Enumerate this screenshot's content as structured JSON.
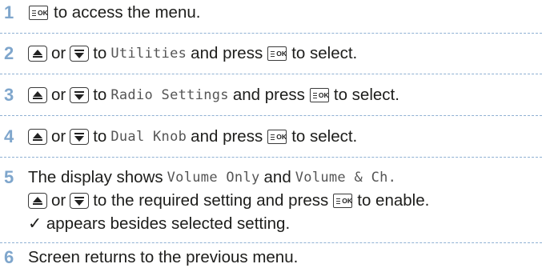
{
  "icons": {
    "ok_key": "menu-ok-key-icon",
    "up_key": "arrow-up-key-icon",
    "down_key": "arrow-down-key-icon",
    "ok_key_label": "OK"
  },
  "colors": {
    "step_number": "#7fa6cc",
    "separator": "#8fb0d3",
    "text": "#1d1d1b",
    "display_text": "#555555"
  },
  "steps": [
    {
      "number": "1",
      "text_after_key": "to access the menu."
    },
    {
      "number": "2",
      "or": "or",
      "to": "to",
      "display_item": "Utilities",
      "and_press": "and press",
      "tail": "to select."
    },
    {
      "number": "3",
      "or": "or",
      "to": "to",
      "display_item": "Radio Settings",
      "and_press": "and press",
      "tail": "to select."
    },
    {
      "number": "4",
      "or": "or",
      "to": "to",
      "display_item": "Dual Knob",
      "and_press": "and press",
      "tail": "to select."
    },
    {
      "number": "5",
      "line1_prefix": "The display shows",
      "option_a": "Volume Only",
      "and": "and",
      "option_b": "Volume & Ch.",
      "or": "or",
      "line2_mid": "to the required setting and press",
      "line2_tail": "to enable.",
      "line3": "✓ appears besides selected setting."
    },
    {
      "number": "6",
      "text": "Screen returns to the previous menu."
    }
  ]
}
